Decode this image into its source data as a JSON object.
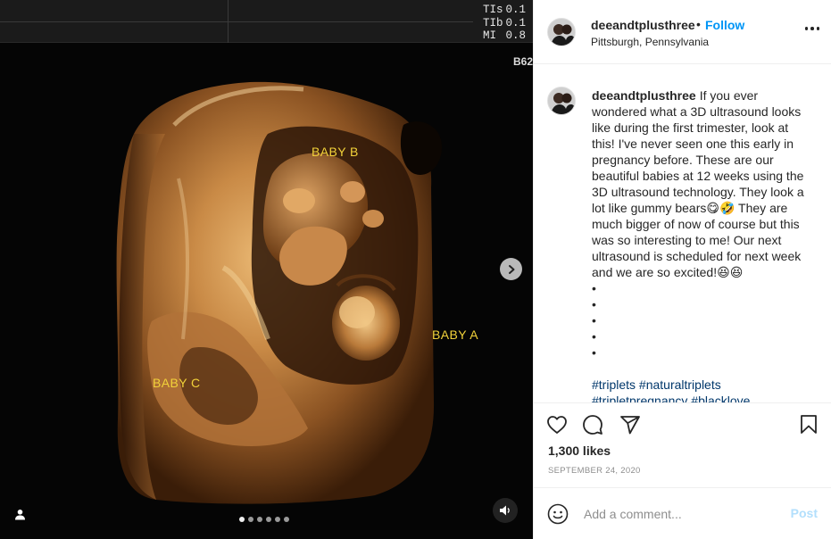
{
  "media": {
    "readout": [
      {
        "label": "TIs",
        "value": "0.1"
      },
      {
        "label": "TIb",
        "value": "0.1"
      },
      {
        "label": "MI",
        "value": "0.8"
      }
    ],
    "code": "B62",
    "labels": {
      "baby_a": "BABY A",
      "baby_b": "BABY B",
      "baby_c": "BABY C"
    },
    "carousel": {
      "count": 6,
      "active_index": 0
    },
    "icons": {
      "next": "chevron-right-icon",
      "user_tag": "user-tag-icon",
      "sound": "speaker-icon"
    }
  },
  "post_header": {
    "username": "deeandtplusthree",
    "separator": "•",
    "follow_label": "Follow",
    "location": "Pittsburgh, Pennsylvania",
    "more_icon": "more-options-icon"
  },
  "caption": {
    "username": "deeandtplusthree",
    "text_1": "If you ever wondered what a 3D ultrasound looks like during the first trimester, look at this! I've never seen one this early in pregnancy before. These are our beautiful babies at 12 weeks using the 3D ultrasound technology. They look a lot like gummy bears",
    "emoji_1": "😋🤣",
    "text_2": " They are much bigger of now of course but this was so interesting to me! Our next ultrasound is scheduled for next week and we are so excited!",
    "emoji_2": "😆😆",
    "bullets": [
      "•",
      "•",
      "•",
      "•",
      "•"
    ],
    "hashtags": "#triplets #naturaltriplets #tripletpregnancy #blacklove"
  },
  "actions": {
    "like_icon": "heart-icon",
    "comment_icon": "comment-icon",
    "share_icon": "share-icon",
    "save_icon": "bookmark-icon"
  },
  "likes": "1,300 likes",
  "date": "SEPTEMBER 24, 2020",
  "comment": {
    "placeholder": "Add a comment...",
    "post_label": "Post",
    "emoji_icon": "emoji-icon"
  },
  "colors": {
    "accent": "#0095f6",
    "post_disabled": "#b2dffc",
    "hashtag": "#00376b",
    "ultrasound_label": "#f2d23a"
  }
}
